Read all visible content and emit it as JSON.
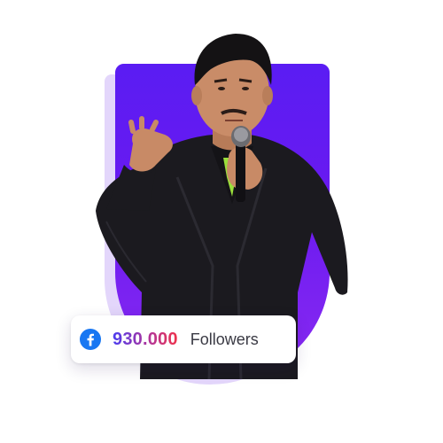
{
  "badge": {
    "icon": "facebook-icon",
    "count": "930.000",
    "label": "Followers"
  },
  "colors": {
    "shape_front": "#6a1af0",
    "shape_back": "#e3d6fb",
    "facebook_blue": "#1877f2",
    "count_gradient_start": "#4a3cf0",
    "count_gradient_end": "#f0324a",
    "label_text": "#3a3a44"
  }
}
